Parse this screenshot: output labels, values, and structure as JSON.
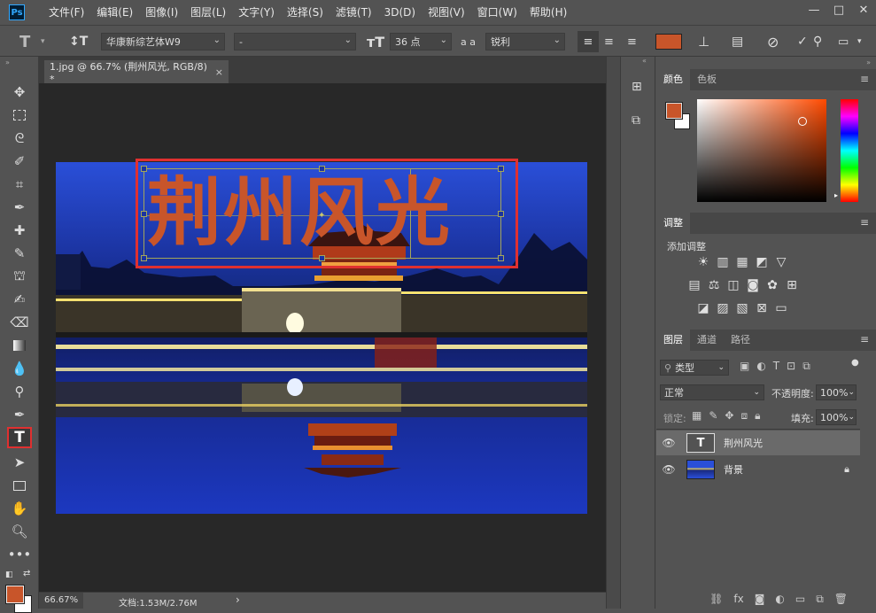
{
  "app": {
    "logo": "Ps"
  },
  "menu": [
    "文件(F)",
    "编辑(E)",
    "图像(I)",
    "图层(L)",
    "文字(Y)",
    "选择(S)",
    "滤镜(T)",
    "3D(D)",
    "视图(V)",
    "窗口(W)",
    "帮助(H)"
  ],
  "window_controls": {
    "min": "—",
    "max": "□",
    "close": "✕"
  },
  "options": {
    "font_family": "华康新综艺体W9",
    "font_style": "-",
    "font_size": "36 点",
    "aa_label": "a a",
    "antialias": "锐利",
    "text_color": "#c8552a"
  },
  "tools": {
    "foreground_color": "#c8552a",
    "background_color": "#ffffff",
    "active": "type-tool"
  },
  "document": {
    "tab_title": "1.jpg @ 66.7% (荆州风光, RGB/8) *",
    "tab_close": "×",
    "overlay_text": "荆州风光",
    "overlay_text_color": "#c8552a",
    "highlight_color": "#e03030"
  },
  "status": {
    "zoom": "66.67%",
    "doc_info": "文档:1.53M/2.76M",
    "arrow": "›"
  },
  "panels": {
    "color": {
      "tabs": [
        "颜色",
        "色板"
      ]
    },
    "adjust": {
      "tab": "调整",
      "add_label": "添加调整"
    },
    "layers": {
      "tabs": [
        "图层",
        "通道",
        "路径"
      ],
      "filter_label": "类型",
      "blend_mode": "正常",
      "opacity_label": "不透明度:",
      "opacity": "100%",
      "lock_label": "锁定:",
      "fill_label": "填充:",
      "fill": "100%",
      "items": [
        {
          "name": "荆州风光",
          "kind": "text",
          "thumb_glyph": "T",
          "selected": true
        },
        {
          "name": "背景",
          "kind": "image",
          "locked": true
        }
      ]
    }
  }
}
